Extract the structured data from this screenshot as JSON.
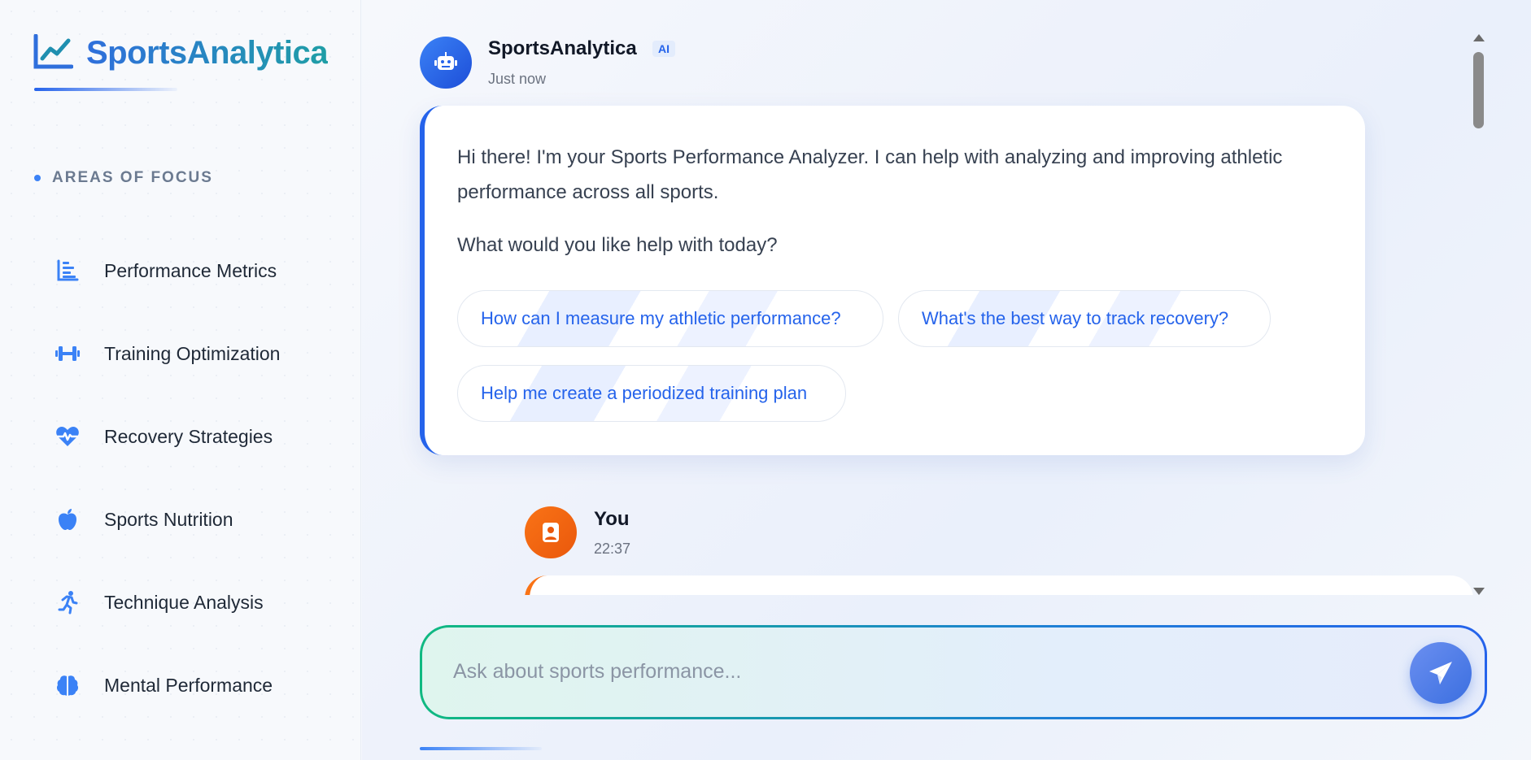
{
  "brand": {
    "name": "SportsAnalytica",
    "icon": "line-chart-icon"
  },
  "sidebar": {
    "heading": "AREAS OF FOCUS",
    "items": [
      {
        "label": "Performance Metrics",
        "icon": "bar-chart-icon"
      },
      {
        "label": "Training Optimization",
        "icon": "dumbbell-icon"
      },
      {
        "label": "Recovery Strategies",
        "icon": "heart-pulse-icon"
      },
      {
        "label": "Sports Nutrition",
        "icon": "apple-icon"
      },
      {
        "label": "Technique Analysis",
        "icon": "running-icon"
      },
      {
        "label": "Mental Performance",
        "icon": "brain-icon"
      }
    ]
  },
  "chat": {
    "bot": {
      "name": "SportsAnalytica",
      "badge": "AI",
      "time": "Just now",
      "message": "Hi there! I'm your Sports Performance Analyzer. I can help with analyzing and improving athletic performance across all sports.",
      "prompt": "What would you like help with today?",
      "suggestions": [
        "How can I measure my athletic performance?",
        "What's the best way to track recovery?",
        "Help me create a periodized training plan"
      ]
    },
    "user": {
      "name": "You",
      "time": "22:37"
    }
  },
  "input": {
    "placeholder": "Ask about sports performance..."
  },
  "colors": {
    "primary": "#2563eb",
    "accent_green": "#10b981",
    "user_orange": "#f97316",
    "text_dark": "#111827"
  }
}
